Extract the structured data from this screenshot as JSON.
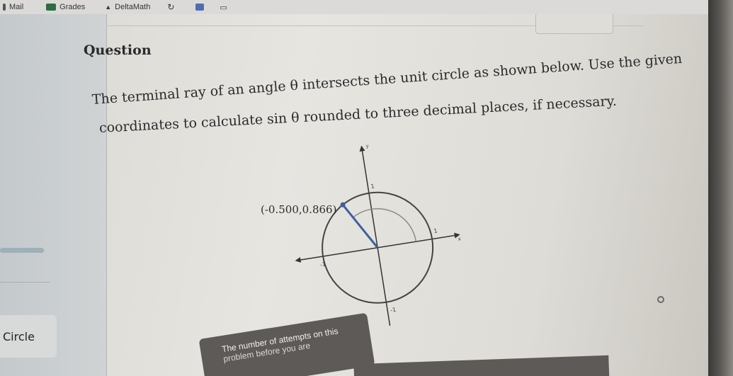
{
  "bookmarks": [
    {
      "label": "Mail",
      "icon": "mail-icon"
    },
    {
      "label": "Grades",
      "icon": "grades-icon"
    },
    {
      "label": "DeltaMath",
      "icon": "deltamath-icon"
    }
  ],
  "sidebar": {
    "circle_label": "Circle"
  },
  "question": {
    "heading": "Question",
    "line1": "The terminal ray of an angle θ intersects the unit circle as shown below. Use the given",
    "line2": "coordinates to calculate sin θ rounded to three decimal places, if necessary."
  },
  "figure": {
    "point_label": "(-0.500,0.866)",
    "axis_x": "x",
    "axis_y": "y",
    "tick_pos_x": "1",
    "tick_neg_x": "-1",
    "tick_pos_y": "1",
    "tick_neg_y": "-1",
    "point_x": -0.5,
    "point_y": 0.866
  },
  "attempts": {
    "line1": "The number of attempts on this",
    "line2": "problem before you are"
  },
  "colors": {
    "ray": "#3f5fa0",
    "circle": "#444444",
    "arc": "#8a8a8a"
  }
}
